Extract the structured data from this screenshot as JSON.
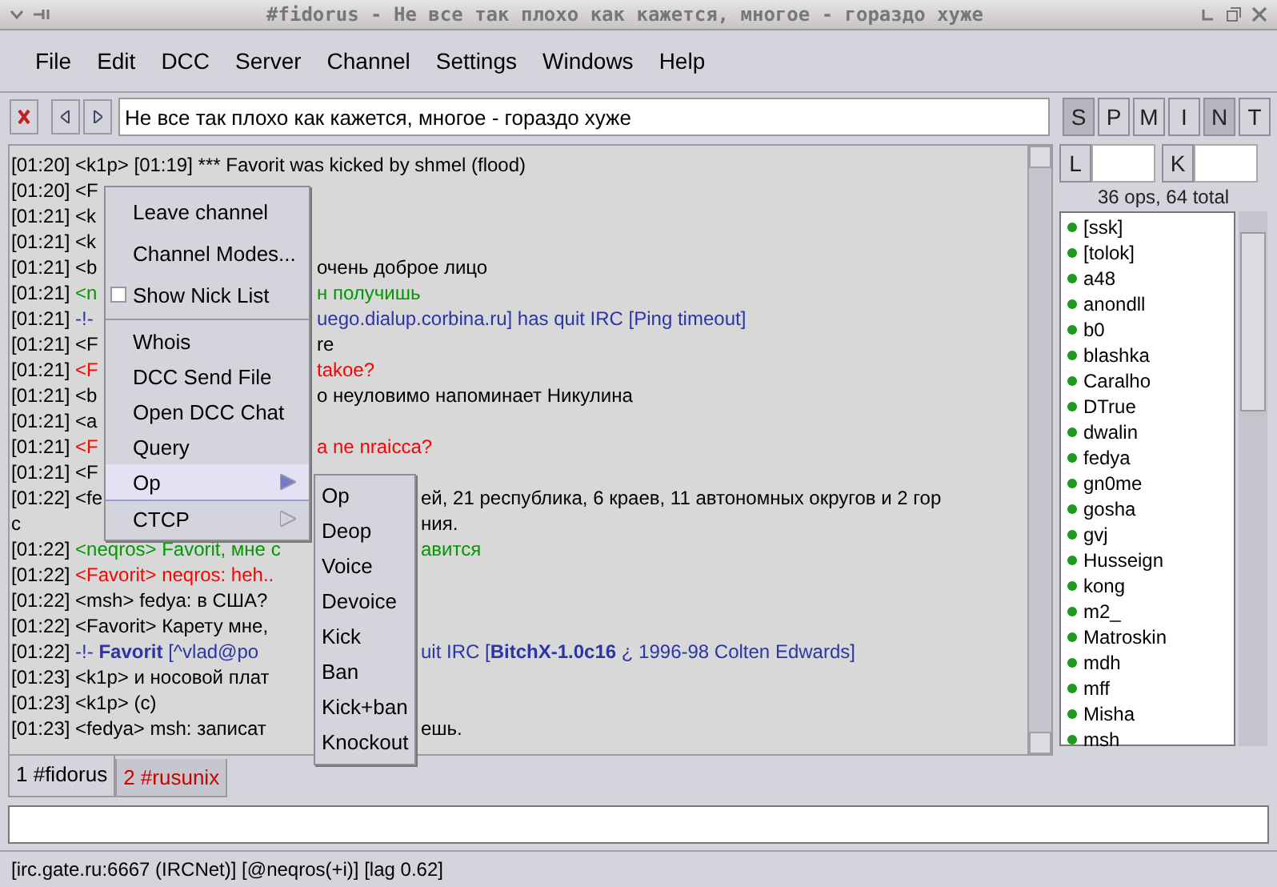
{
  "window": {
    "title": "#fidorus - Не все так плохо как кажется, многое - гораздо хуже"
  },
  "menubar": [
    "File",
    "Edit",
    "DCC",
    "Server",
    "Channel",
    "Settings",
    "Windows",
    "Help"
  ],
  "toolbar": {
    "topic": "Не все так плохо как кажется, многое - гораздо хуже",
    "modes": [
      {
        "label": "S",
        "on": true
      },
      {
        "label": "P",
        "on": false
      },
      {
        "label": "M",
        "on": false
      },
      {
        "label": "I",
        "on": false
      },
      {
        "label": "N",
        "on": true
      },
      {
        "label": "T",
        "on": false
      }
    ],
    "limit_label": "L",
    "key_label": "K"
  },
  "chat": [
    {
      "time": "[01:20]",
      "kind": "plain",
      "left": "<k1p> [01:19] *** Favorit was kicked by shmel (flood)",
      "color": "#000000"
    },
    {
      "time": "[01:20]",
      "kind": "menu",
      "left": "<F",
      "color": "#000000"
    },
    {
      "time": "[01:21]",
      "kind": "menu",
      "left": "<k",
      "color": "#000000"
    },
    {
      "time": "[01:21]",
      "kind": "menu",
      "left": "<k",
      "color": "#000000"
    },
    {
      "time": "[01:21]",
      "kind": "menu",
      "left": "<b",
      "right": "очень доброе лицо",
      "color": "#000000"
    },
    {
      "time": "[01:21]",
      "kind": "menu",
      "left": "<n",
      "right": "н получишь",
      "color": "#009900"
    },
    {
      "time": "[01:21]",
      "kind": "menu",
      "left": "-!-",
      "right": "uego.dialup.corbina.ru] has quit IRC [Ping timeout]",
      "color": "#2c35a8"
    },
    {
      "time": "[01:21]",
      "kind": "menu",
      "left": "<F",
      "right": "re",
      "color": "#000000"
    },
    {
      "time": "[01:21]",
      "kind": "menu",
      "left": "<F",
      "right": "takoe?",
      "color": "#ff0000"
    },
    {
      "time": "[01:21]",
      "kind": "menu",
      "left": "<b",
      "right": "о неуловимо напоминает Никулина",
      "color": "#000000"
    },
    {
      "time": "[01:21]",
      "kind": "menu",
      "left": "<a",
      "color": "#000000"
    },
    {
      "time": "[01:21]",
      "kind": "menu",
      "left": "<F",
      "right": "a ne nraicca?",
      "color": "#ff0000"
    },
    {
      "time": "[01:21]",
      "kind": "menu",
      "left": "<F",
      "color": "#000000"
    },
    {
      "time": "[01:22]",
      "kind": "both",
      "left": "<fe",
      "right": "ей, 21 республика, 6 краев, 11 автономных округов и 2 гор",
      "color": "#000000"
    },
    {
      "kind": "both",
      "left": "с",
      "right": "ния.",
      "color": "#000000"
    },
    {
      "time": "[01:22]",
      "kind": "submenu",
      "left": "<neqros> Favorit, мне с",
      "right": "авится",
      "color": "#009900"
    },
    {
      "time": "[01:22]",
      "kind": "submenu",
      "left": "<Favorit> neqros: heh..",
      "color": "#ff0000"
    },
    {
      "time": "[01:22]",
      "kind": "submenu",
      "left": "<msh> fedya: в США?",
      "color": "#000000"
    },
    {
      "time": "[01:22]",
      "kind": "submenu",
      "left": "<Favorit> Карету мне,",
      "color": "#000000"
    },
    {
      "time": "[01:22]",
      "kind": "submenu",
      "left": "-!- **Favorit** [^vlad@po",
      "right": "uit IRC [**BitchX-1.0c16** ¿ 1996-98 Colten Edwards]",
      "color": "#2c35a8"
    },
    {
      "time": "[01:23]",
      "kind": "submenu",
      "left": "<k1p> и носовой плат",
      "color": "#000000"
    },
    {
      "time": "[01:23]",
      "kind": "submenu",
      "left": "<k1p> (c)",
      "color": "#000000"
    },
    {
      "time": "[01:23]",
      "kind": "submenu",
      "left": "<fedya> msh: записат",
      "right": "ешь.",
      "color": "#000000"
    }
  ],
  "nicklist": {
    "summary": "36 ops, 64 total",
    "users": [
      "[ssk]",
      "[tolok]",
      "a48",
      "anondll",
      "b0",
      "blashka",
      "Caralho",
      "DTrue",
      "dwalin",
      "fedya",
      "gn0me",
      "gosha",
      "gvj",
      "Husseign",
      "kong",
      "m2_",
      "Matroskin",
      "mdh",
      "mff",
      "Misha",
      "msh"
    ]
  },
  "tabs": [
    {
      "label": "1 #fidorus",
      "selected": true,
      "color": "#000000"
    },
    {
      "label": "2 #rusunix",
      "selected": false,
      "color": "#cc0000"
    }
  ],
  "status_bar": "[irc.gate.ru:6667 (IRCNet)] [@neqros(+i)] [lag 0.62]",
  "context_menu": {
    "groups": [
      [
        {
          "label": "Leave channel",
          "kind": "action",
          "selected": false
        },
        {
          "label": "Channel Modes...",
          "kind": "action",
          "selected": false
        },
        {
          "label": "Show Nick List",
          "kind": "check",
          "checked": false,
          "selected": false
        }
      ],
      [
        {
          "label": "Whois",
          "kind": "action",
          "selected": false
        },
        {
          "label": "DCC Send File",
          "kind": "action",
          "selected": false
        },
        {
          "label": "Open DCC Chat",
          "kind": "action",
          "selected": false
        },
        {
          "label": "Query",
          "kind": "action",
          "selected": false
        },
        {
          "label": "Op",
          "kind": "submenu",
          "selected": true
        },
        {
          "label": "CTCP",
          "kind": "submenu",
          "selected": false
        }
      ]
    ]
  },
  "submenu": {
    "items": [
      "Op",
      "Deop",
      "Voice",
      "Devoice",
      "Kick",
      "Ban",
      "Kick+ban",
      "Knockout"
    ]
  }
}
